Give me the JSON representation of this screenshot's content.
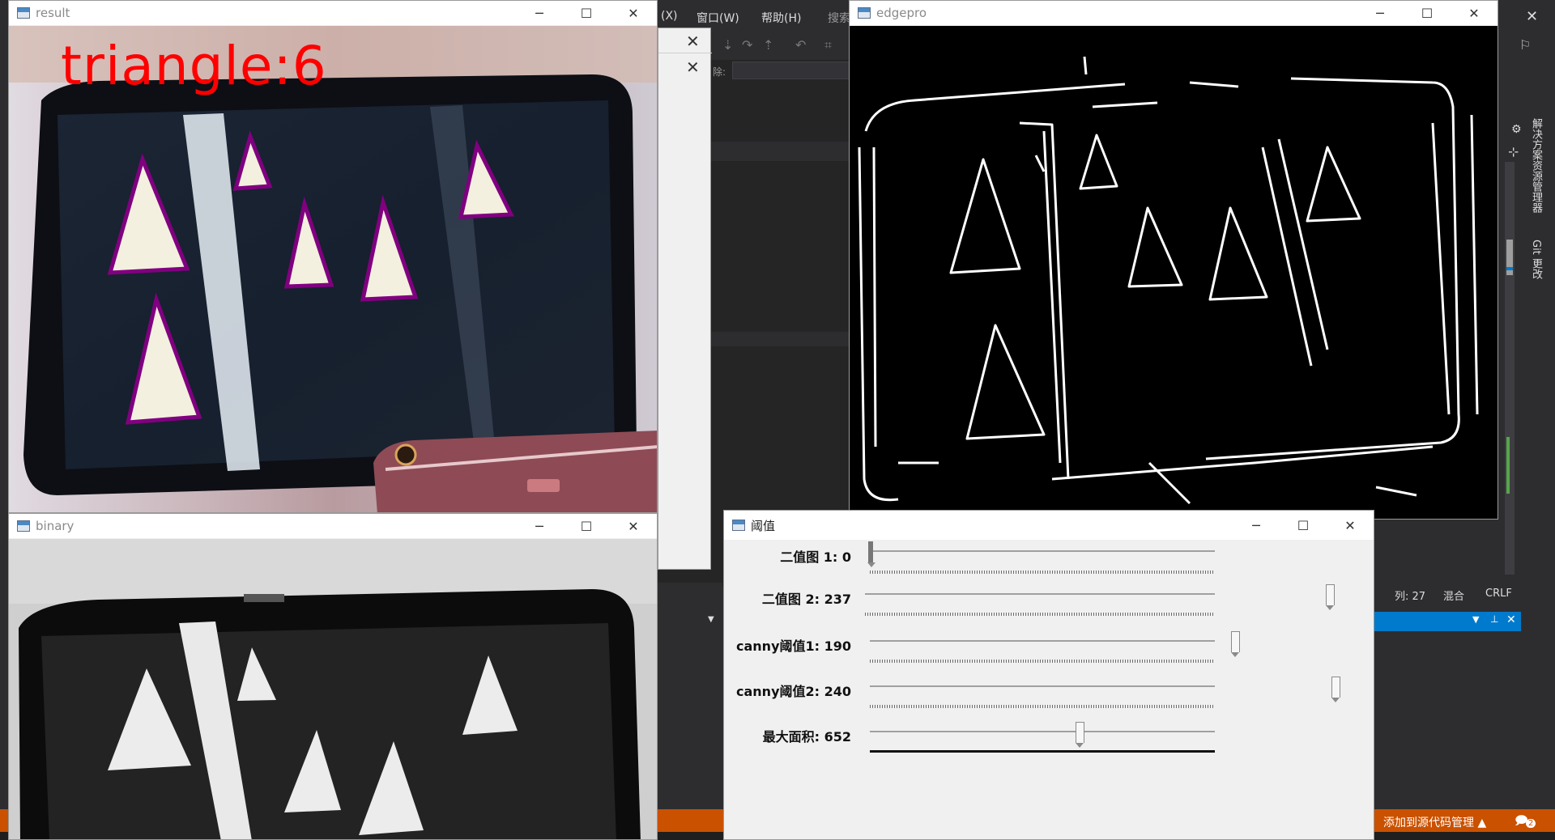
{
  "ide": {
    "menu": [
      {
        "label": "窗口(W)"
      },
      {
        "label": "帮助(H)"
      },
      {
        "label": "搜索"
      }
    ],
    "menu_partial": "(X)",
    "right_panel_tabs": [
      "解决方案资源管理器",
      "Git 更改"
    ],
    "status": {
      "col": "列: 27",
      "mixed": "混合",
      "eol": "CRLF"
    },
    "source_control": "添加到源代码管理",
    "notification_count": "2",
    "inner_label": "除:"
  },
  "windows": {
    "result": {
      "title": "result",
      "overlay_text": "triangle:6"
    },
    "binary": {
      "title": "binary"
    },
    "edgepro": {
      "title": "edgepro"
    },
    "threshold": {
      "title": "阈值",
      "sliders": [
        {
          "label": "二值图 1: 0",
          "value": 0,
          "max": 255
        },
        {
          "label": "二值图 2: 237",
          "value": 237,
          "max": 255
        },
        {
          "label": "canny阈值1: 190",
          "value": 190,
          "max": 255
        },
        {
          "label": "canny阈值2: 240",
          "value": 240,
          "max": 255
        },
        {
          "label": "最大面积: 652",
          "value": 652,
          "max": 1500
        }
      ]
    }
  },
  "colors": {
    "ide_bg": "#2d2d30",
    "status_orange": "#ca5100",
    "accent_blue": "#007acc",
    "overlay_red": "#ff0000",
    "triangle_outline": "#800080"
  }
}
